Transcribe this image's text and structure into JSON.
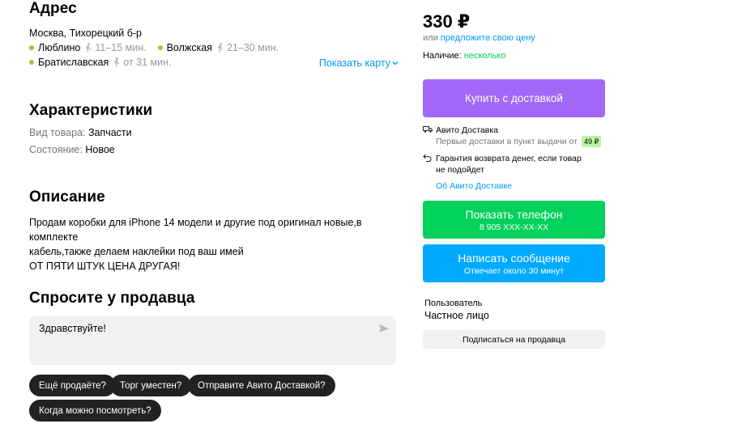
{
  "address": {
    "title": "Адрес",
    "line": "Москва, Тихорецкий б-р",
    "metro": [
      {
        "name": "Люблино",
        "time": "11–15 мин.",
        "color": "#a2c639"
      },
      {
        "name": "Волжская",
        "time": "21–30 мин.",
        "color": "#a2c639"
      },
      {
        "name": "Братиславская",
        "time": "от 31 мин.",
        "color": "#a2c639"
      }
    ],
    "map_link": "Показать карту"
  },
  "characteristics": {
    "title": "Характеристики",
    "rows": [
      {
        "key": "Вид товара:",
        "value": "Запчасти"
      },
      {
        "key": "Состояние:",
        "value": "Новое"
      }
    ]
  },
  "description": {
    "title": "Описание",
    "lines": [
      "Продам коробки для iPhone 14 модели и другие под оригинал новые,в комплекте",
      "кабель,также делаем наклейки под ваш имей",
      "ОТ ПЯТИ ШТУК ЦЕНА ДРУГАЯ!"
    ]
  },
  "ask": {
    "title": "Спросите у продавца",
    "message": "Здравствуйте!",
    "chips": [
      "Ещё продаёте?",
      "Торг уместен?",
      "Отправите Авито Доставкой?",
      "Когда можно посмотреть?"
    ]
  },
  "sidebar": {
    "price": "330 ₽",
    "offer_prefix": "или",
    "offer_link": "предложите свою цену",
    "availability_label": "Наличие:",
    "availability_value": "несколько",
    "buy_button": "Купить с доставкой",
    "delivery_title": "Авито Доставка",
    "delivery_sub": "Первые доставки в пункт выдачи от",
    "delivery_badge": "49 ₽",
    "guarantee_line1": "Гарантия возврата денег, если товар",
    "guarantee_line2": "не подойдет",
    "about_link": "Об Авито Доставке",
    "phone_button": "Показать телефон",
    "phone_number": "8 905 XXX-XX-XX",
    "message_button": "Написать сообщение",
    "message_sub": "Отвечает около 30 минут",
    "user_label": "Пользователь",
    "user_type": "Частное лицо",
    "subscribe_button": "Подписаться на продавца"
  },
  "colors": {
    "buy": "#a168f7",
    "phone": "#02d15c",
    "message": "#00aaff",
    "link": "#0099f7"
  }
}
